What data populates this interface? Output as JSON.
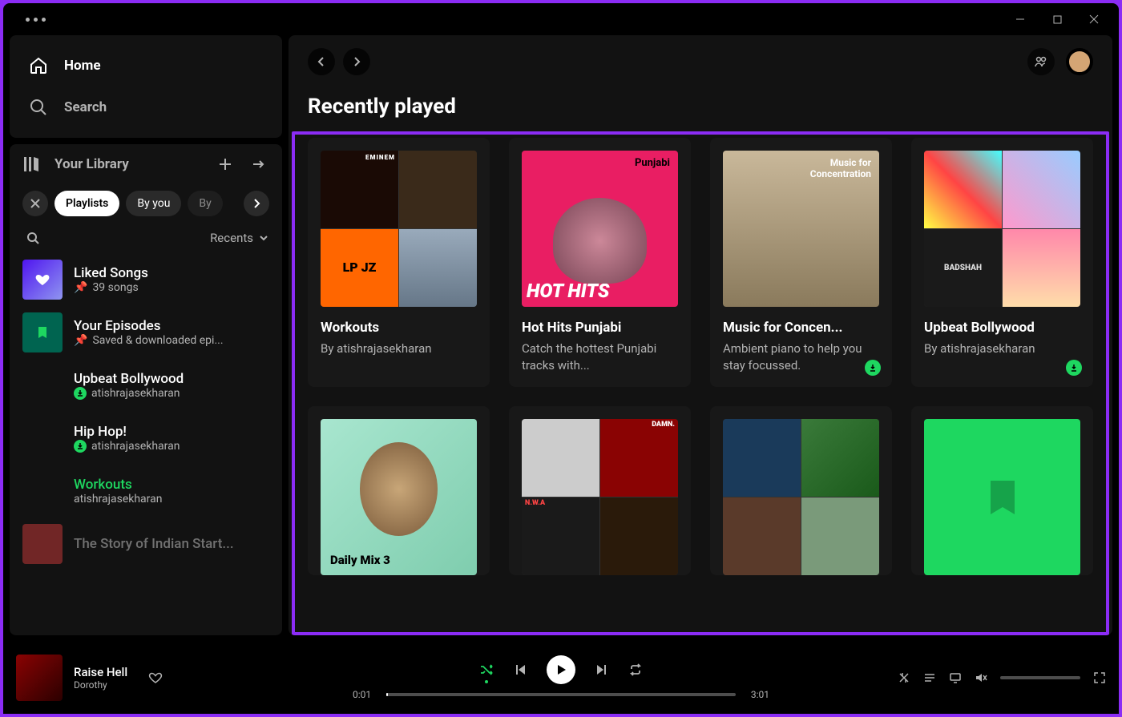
{
  "nav": {
    "home": "Home",
    "search": "Search"
  },
  "library": {
    "title": "Your Library",
    "chips": {
      "playlists": "Playlists",
      "byyou": "By you",
      "by": "By"
    },
    "recents": "Recents",
    "items": [
      {
        "name": "Liked Songs",
        "meta": "39 songs",
        "pinned": true
      },
      {
        "name": "Your Episodes",
        "meta": "Saved & downloaded epi...",
        "pinned": true
      },
      {
        "name": "Upbeat Bollywood",
        "meta": "atishrajasekharan",
        "dl": true
      },
      {
        "name": "Hip Hop!",
        "meta": "atishrajasekharan",
        "dl": true
      },
      {
        "name": "Workouts",
        "meta": "atishrajasekharan",
        "active": true
      },
      {
        "name": "The Story of Indian Start..."
      }
    ]
  },
  "section": {
    "title": "Recently played"
  },
  "cards": [
    {
      "title": "Workouts",
      "desc": "By atishrajasekharan"
    },
    {
      "title": "Hot Hits Punjabi",
      "desc": "Catch the hottest Punjabi tracks with..."
    },
    {
      "title": "Music for Concen...",
      "desc": "Ambient piano to help you stay focussed.",
      "dl": true
    },
    {
      "title": "Upbeat Bollywood",
      "desc": "By atishrajasekharan",
      "dl": true
    },
    {
      "title": "Daily Mix 3",
      "desc": ""
    },
    {
      "title": "",
      "desc": ""
    },
    {
      "title": "",
      "desc": ""
    },
    {
      "title": "",
      "desc": ""
    }
  ],
  "coverText": {
    "eminem": "EMINEM",
    "lpjz": "LP JZ",
    "punjabi": "Punjabi",
    "hothits": "HOT HITS",
    "concen1": "Music for",
    "concen2": "Concentration",
    "badshah": "BADSHAH",
    "dailymix": "Daily Mix 3",
    "damn": "DAMN.",
    "nwa": "N.W.A"
  },
  "player": {
    "track": "Raise Hell",
    "artist": "Dorothy",
    "elapsed": "0:01",
    "total": "3:01"
  }
}
